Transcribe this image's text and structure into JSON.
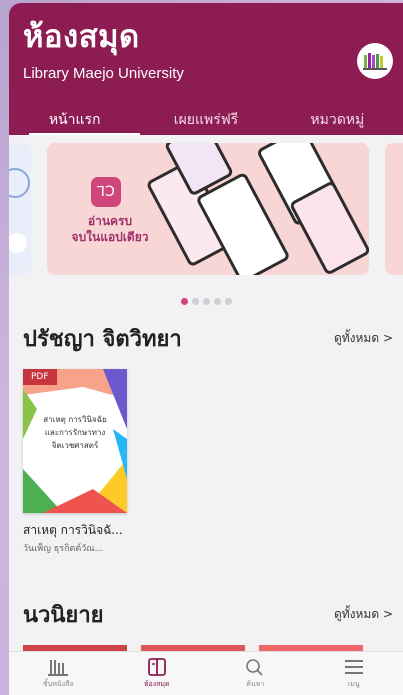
{
  "header": {
    "title": "ห้องสมุด",
    "subtitle": "Library Maejo University",
    "logo_icon": "library-books-icon"
  },
  "tabs": [
    {
      "label": "หน้าแรก",
      "active": true
    },
    {
      "label": "เผยแพร่ฟรี",
      "active": false
    },
    {
      "label": "หมวดหมู่",
      "active": false
    }
  ],
  "banner": {
    "slide_text_line1": "อ่านครบ",
    "slide_text_line2": "จบในแอปเดียว",
    "app_icon_text": "ꓶƆ",
    "dots_count": 5,
    "active_dot": 0
  },
  "sections": [
    {
      "title": "ปรัชญา จิตวิทยา",
      "see_all": "ดูทั้งหมด >",
      "books": [
        {
          "badge": "PDF",
          "cover_text": "สาเหตุ การวินิจฉัย และการรักษาทาง จิตเวชศาสตร์",
          "title": "สาเหตุ การวินิจฉั...",
          "author": "วันเพ็ญ ธุรกิตต์วัณ..."
        }
      ]
    },
    {
      "title": "นวนิยาย",
      "see_all": "ดูทั้งหมด >"
    }
  ],
  "bottom_nav": [
    {
      "label": "ชั้นหนังสือ",
      "icon": "bookshelf-icon",
      "active": false
    },
    {
      "label": "ห้องสมุด",
      "icon": "library-icon",
      "active": true
    },
    {
      "label": "ค้นหา",
      "icon": "search-icon",
      "active": false
    },
    {
      "label": "เมนู",
      "icon": "menu-icon",
      "active": false
    }
  ],
  "colors": {
    "brand": "#8c1c52",
    "accent": "#d0457c",
    "background": "#f2f2f4"
  }
}
